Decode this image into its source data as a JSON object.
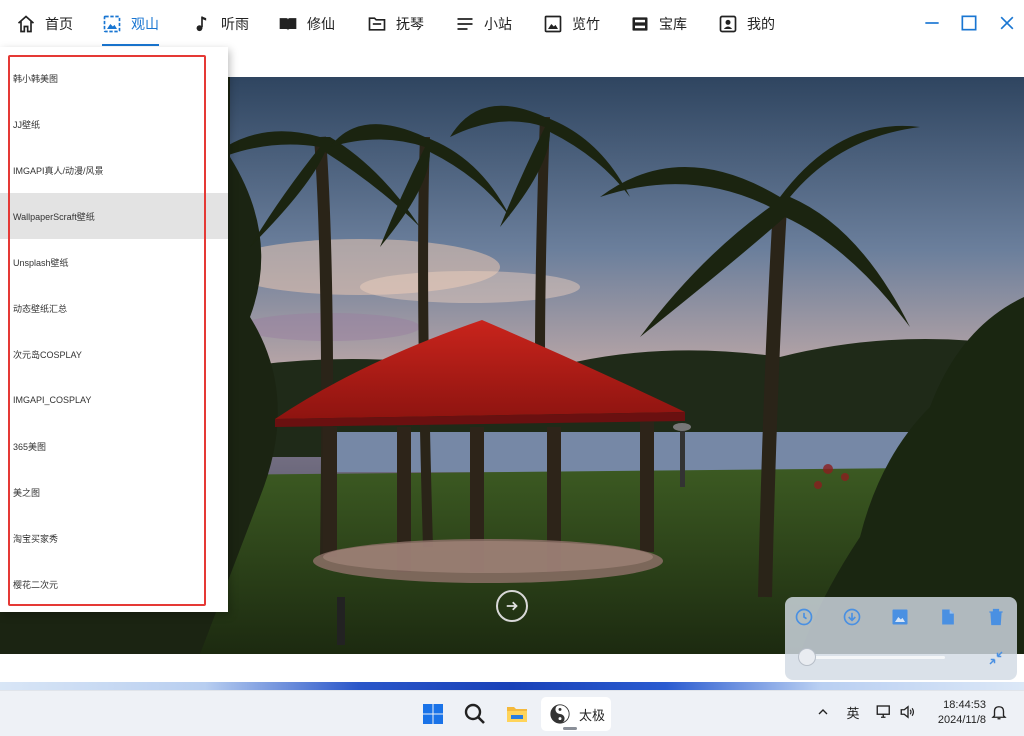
{
  "nav": {
    "items": [
      {
        "label": "首页",
        "icon": "home-icon"
      },
      {
        "label": "观山",
        "icon": "image-gallery-icon",
        "active": true
      },
      {
        "label": "听雨",
        "icon": "music-note-icon"
      },
      {
        "label": "修仙",
        "icon": "book-icon"
      },
      {
        "label": "抚琴",
        "icon": "folder-icon"
      },
      {
        "label": "小站",
        "icon": "menu-lines-icon"
      },
      {
        "label": "览竹",
        "icon": "picture-icon"
      },
      {
        "label": "宝库",
        "icon": "treasure-box-icon"
      },
      {
        "label": "我的",
        "icon": "user-profile-icon"
      }
    ],
    "accent_color": "#1976d2"
  },
  "window_controls": [
    "minimize-icon",
    "maximize-icon",
    "close-icon"
  ],
  "menu": {
    "items": [
      "韩小韩美图",
      "JJ壁纸",
      "IMGAPI真人/动漫/风景",
      "WallpaperScraft壁纸",
      "Unsplash壁纸",
      "动态壁纸汇总",
      "次元岛COSPLAY",
      "IMGAPI_COSPLAY",
      "365美图",
      "美之图",
      "淘宝买家秀",
      "樱花二次元"
    ],
    "selected_index": 3,
    "highlight_color": "#e53935"
  },
  "panel": {
    "icons": [
      "history-icon",
      "download-icon",
      "set-wallpaper-icon",
      "copy-icon",
      "delete-icon"
    ],
    "slider_value": 0,
    "shrink_icon": "shrink-icon",
    "icon_color": "#4a90e2"
  },
  "taskbar": {
    "apps": [
      "windows-start-icon",
      "search-icon",
      "file-explorer-icon"
    ],
    "active_app": {
      "icon": "taiji-icon",
      "label": "太极"
    },
    "tray": {
      "chevron": "chevron-up-icon",
      "ime": "英",
      "network": "network-icon",
      "volume": "volume-icon",
      "time": "18:44:53",
      "date": "2024/11/8",
      "notification": "bell-icon"
    }
  }
}
